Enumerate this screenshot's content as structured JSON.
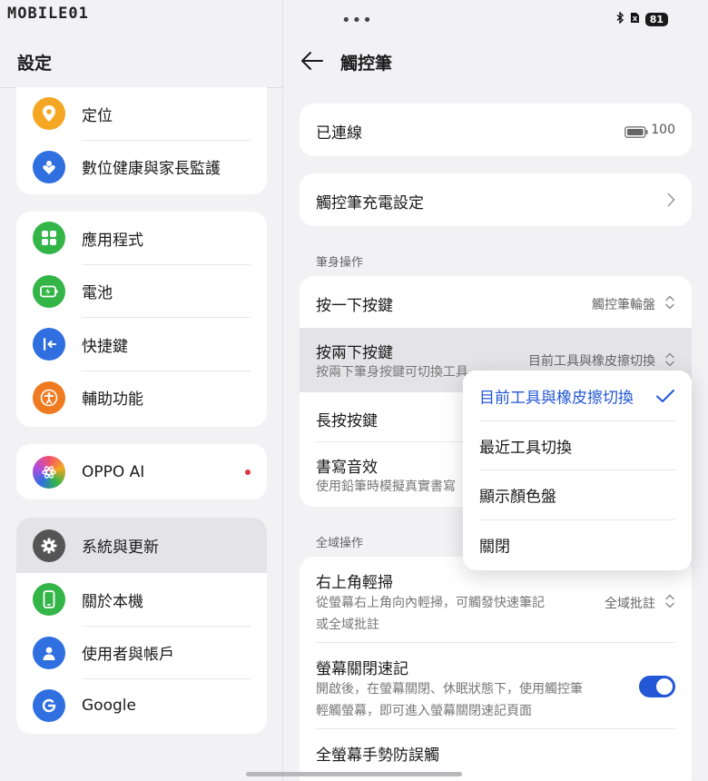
{
  "watermark": "MOBILE01",
  "left": {
    "title": "設定",
    "group1": [
      {
        "label": "定位",
        "icon": "location-pin-icon",
        "color": "#f5a623"
      },
      {
        "label": "數位健康與家長監護",
        "icon": "heart-icon",
        "color": "#2f6fe0"
      }
    ],
    "group2": [
      {
        "label": "應用程式",
        "icon": "apps-grid-icon",
        "color": "#33b548"
      },
      {
        "label": "電池",
        "icon": "battery-icon",
        "color": "#33b548"
      },
      {
        "label": "快捷鍵",
        "icon": "shortcut-icon",
        "color": "#2f6fe0"
      },
      {
        "label": "輔助功能",
        "icon": "accessibility-icon",
        "color": "#f07a1f"
      }
    ],
    "group3": [
      {
        "label": "OPPO AI",
        "icon": "oppo-ai-icon",
        "color": "#b04ce0"
      }
    ],
    "group4": [
      {
        "label": "系統與更新",
        "icon": "gear-icon",
        "color": "#555555"
      },
      {
        "label": "關於本機",
        "icon": "phone-icon",
        "color": "#33b548"
      },
      {
        "label": "使用者與帳戶",
        "icon": "user-icon",
        "color": "#2f6fe0"
      },
      {
        "label": "Google",
        "icon": "google-icon",
        "color": "#2f6fe0"
      }
    ]
  },
  "right": {
    "status": {
      "dots": "•••",
      "battery": "81"
    },
    "title": "觸控筆",
    "connected": {
      "label": "已連線",
      "battery_value": "100"
    },
    "charging": {
      "label": "觸控筆充電設定"
    },
    "section_pen": "筆身操作",
    "single_press": {
      "label": "按一下按鍵",
      "value": "觸控筆輪盤"
    },
    "double_press": {
      "label": "按兩下按鍵",
      "sub": "按兩下筆身按鍵可切換工具",
      "value": "目前工具與橡皮擦切換"
    },
    "long_press": {
      "label": "長按按鍵"
    },
    "writing_sound": {
      "label": "書寫音效",
      "sub": "使用鉛筆時模擬真實書寫"
    },
    "section_global": "全域操作",
    "swipe": {
      "label": "右上角輕掃",
      "sub1": "從螢幕右上角向內輕掃，可觸發快速筆記",
      "sub2": "或全域批註",
      "value": "全域批註"
    },
    "screen_off": {
      "label": "螢幕關閉速記",
      "sub1": "開啟後，在螢幕關閉、休眠狀態下，使用觸控筆",
      "sub2": "輕觸螢幕，即可進入螢幕關閉速記頁面"
    },
    "palm": {
      "label": "全螢幕手勢防誤觸"
    }
  },
  "dropdown": {
    "options": [
      "目前工具與橡皮擦切換",
      "最近工具切換",
      "顯示顏色盤",
      "關閉"
    ],
    "selected_color": "#2457d6"
  }
}
